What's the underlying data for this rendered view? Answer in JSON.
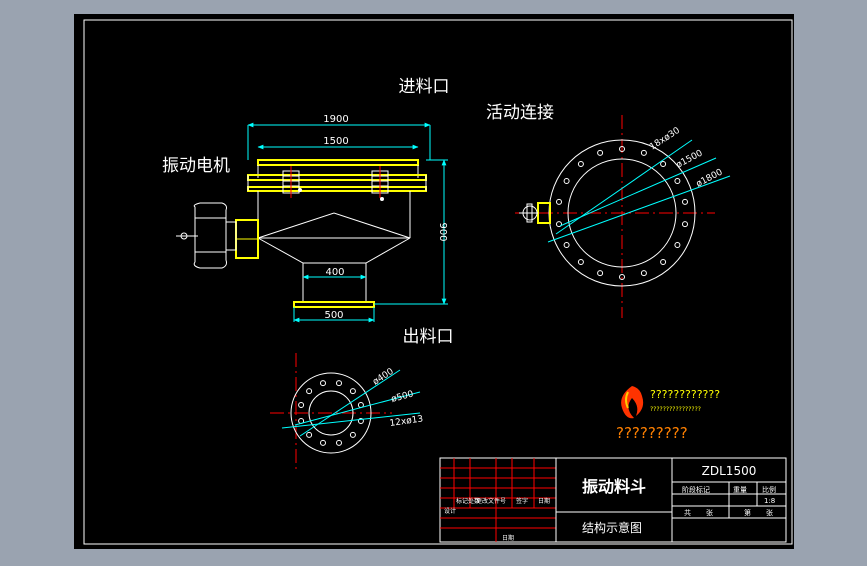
{
  "labels": {
    "inlet": "进料口",
    "flex_connection": "活动连接",
    "vibration_motor": "振动电机",
    "outlet": "出料口"
  },
  "dimensions": {
    "top_outer": "1900",
    "top_inner": "1500",
    "height": "900",
    "outlet_inner": "400",
    "outlet_flange": "500",
    "top_holes": "18xø30",
    "top_d1": "ø1500",
    "top_d2": "ø1800",
    "bot_d1": "ø400",
    "bot_d2": "ø500",
    "bot_holes": "12xø13"
  },
  "logo": {
    "line1": "????????????",
    "line2": "????????????????",
    "line3": "?????????"
  },
  "title_block": {
    "drawing_no": "ZDL1500",
    "name": "振动料斗",
    "subtitle": "结构示意图",
    "scale": "1:8",
    "hdr_stage": "阶段标记",
    "hdr_weight": "重量",
    "hdr_scale": "比例",
    "sheet_total": "共",
    "sheet_of": "第",
    "sheet_unit": "张",
    "row_labels": [
      "标记",
      "处数",
      "更改文件号",
      "签字",
      "日期"
    ],
    "design": "设计",
    "date": "日期"
  },
  "colors": {
    "frame": "#ffffff",
    "yellow": "#ffff00",
    "cyan": "#00ffff",
    "red": "#ff0000",
    "orange": "#ff8000"
  }
}
